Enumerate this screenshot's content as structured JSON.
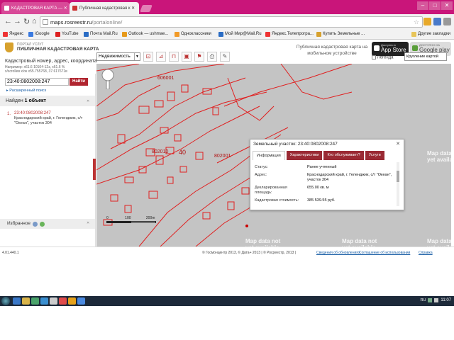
{
  "browser": {
    "tabs": [
      {
        "label": "КАДАСТРОВАЯ КАРТА — ✕"
      },
      {
        "label": "Публичная кадастровая к ✕"
      }
    ],
    "url_host": "maps.rosreestr.ru",
    "url_path": "/portalonline/",
    "bookmarks": [
      "Яндекс",
      "iGoogle",
      "YouTube",
      "Почта Mail.Ru",
      "Outlook — ushmae...",
      "Одноклассники",
      "Мой Мир@Mail.Ru",
      "Яндекс.Телепрогра...",
      "Купить Земельные ..."
    ],
    "other_bookmarks": "Другие закладки"
  },
  "header": {
    "portal": "ПОРТАЛ УСЛУГ",
    "title": "ПУБЛИЧНАЯ КАДАСТРОВАЯ КАРТА",
    "mobile_text": "Публичная кадастровая карта на мобильном устройстве",
    "app_store_small": "Доступно в",
    "app_store": "App Store",
    "google_play_small": "ДОСТУПНО НА",
    "google_play": "Google play",
    "search_label": "Кадастровый номер, адрес, координата",
    "coords_line1": "Например: x61.6 10104-12з, x61.6 %",
    "coords_line2": "x/scrollев x/ок x55.755768, 37.617671в"
  },
  "maptools": {
    "layer_select": "Недвижимость",
    "legend": "Легенда",
    "basemap": "Кругление картой"
  },
  "left": {
    "search_value": "23:40:0802008:247",
    "search_button": "Найти",
    "advanced_search": "▸ Расширенный поиск",
    "found_prefix": "Найден",
    "found_count": "1 объект",
    "result_index": "1.",
    "result_number": "23:40:0802008:247",
    "result_address": "Краснодарский край, г. Геленджик, с/т \"Океан\", участок 304",
    "favorites": "Избранное"
  },
  "map": {
    "labels": [
      "606001",
      "802001",
      "40",
      "802010"
    ],
    "watermark": "Map data not\nyet available",
    "scale_left": "0",
    "scale_mid": "100",
    "scale_right": "200m"
  },
  "popup": {
    "title": "Земельный участок: 23:40:0802008:247",
    "close": "✕",
    "tabs": [
      "Информация",
      "Характеристики",
      "Кто обслуживает?",
      "Услуги"
    ],
    "rows": [
      {
        "k": "Статус:",
        "v": "Ранее учтенный"
      },
      {
        "k": "Адрес:",
        "v": "Краснодарский край, г. Геленджик, с/т \"Океан\", участок 304"
      },
      {
        "k": "Декларированная площадь:",
        "v": "655.00 кв. м"
      },
      {
        "k": "Кадастровая стоимость:",
        "v": "385 539.55 руб."
      }
    ]
  },
  "footer": {
    "version": "4.01.440.1",
    "copyright": "© Госмонцентр 2013, © Дата+ 2013 | © Росреестр, 2013 |",
    "links": [
      "Сведения об обновлениях",
      "Соглашение об использовании",
      "Справка"
    ]
  },
  "taskbar": {
    "lang": "RU",
    "time": "11:07"
  },
  "colors": {
    "accent": "#b0252f",
    "tabstrip": "#c9157a",
    "parcel_line": "#e02020"
  }
}
